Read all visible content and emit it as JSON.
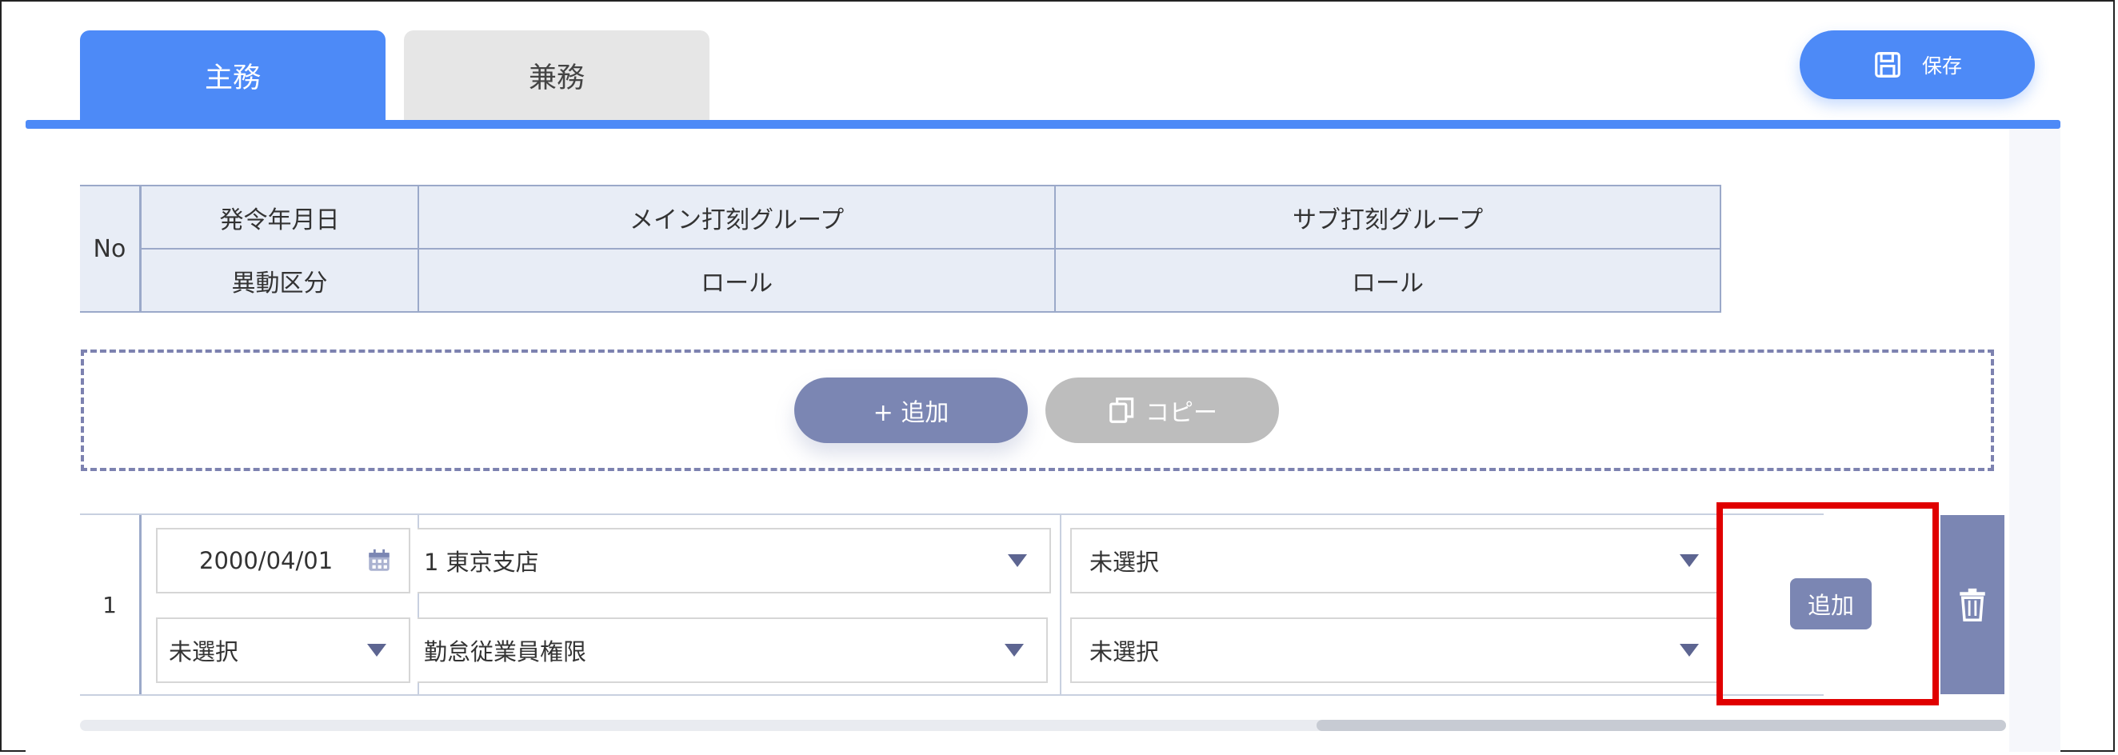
{
  "tabs": {
    "primary": "主務",
    "secondary": "兼務"
  },
  "toolbar": {
    "save_label": "保存"
  },
  "table_header": {
    "no": "No",
    "issue_date": "発令年月日",
    "main_group": "メイン打刻グループ",
    "sub_group": "サブ打刻グループ",
    "transfer_type": "異動区分",
    "main_role": "ロール",
    "sub_role": "ロール"
  },
  "actions": {
    "add": "+  追加",
    "copy": "コピー"
  },
  "row": {
    "no": "1",
    "date": "2000/04/01",
    "main_group": "1 東京支店",
    "sub_group": "未選択",
    "transfer_type": "未選択",
    "main_role": "勤怠従業員権限",
    "sub_role": "未選択",
    "add_button": "追加"
  },
  "icons": [
    "save-icon",
    "copy-icon",
    "calendar-icon",
    "chevron-down-icon",
    "trash-icon"
  ],
  "colors": {
    "accent": "#4d8af7",
    "secondary": "#7b86b3",
    "highlight": "#e00000"
  }
}
